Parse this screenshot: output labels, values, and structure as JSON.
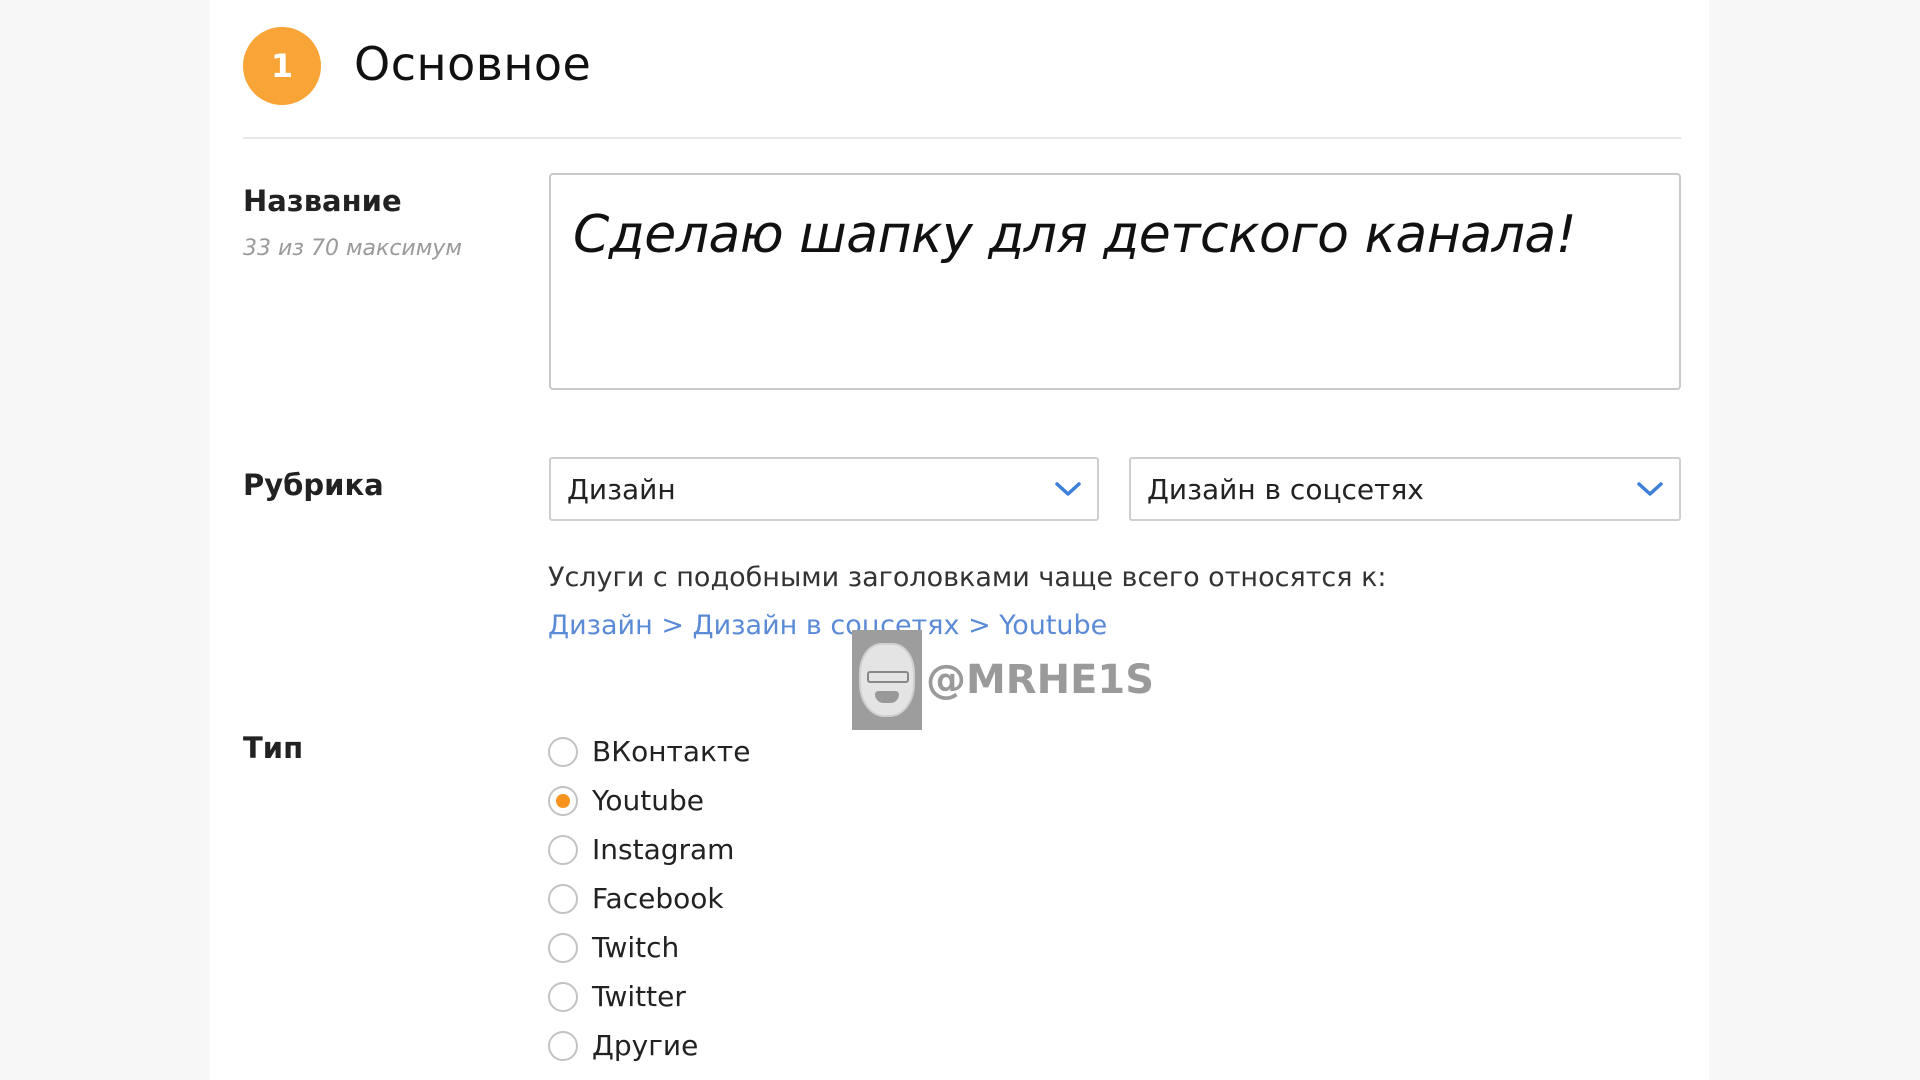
{
  "section": {
    "step_number": "1",
    "title": "Основное"
  },
  "name_field": {
    "label": "Название",
    "counter": "33 из 70 максимум",
    "value": "Сделаю шапку для детского канала!"
  },
  "category": {
    "label": "Рубрика",
    "primary_selected": "Дизайн",
    "secondary_selected": "Дизайн в соцсетях",
    "chevron_icon": "chevron-down-icon",
    "chevron_color": "#3d7fd9",
    "suggestion_text": "Услуги с подобными заголовками чаще всего относятся к:",
    "suggestion_link": "Дизайн > Дизайн в соцсетях > Youtube",
    "link_color": "#5b8bd6"
  },
  "type": {
    "label": "Тип",
    "selected": "Youtube",
    "accent_color": "#f7931e",
    "options": [
      {
        "label": "ВКонтакте",
        "checked": false
      },
      {
        "label": "Youtube",
        "checked": true
      },
      {
        "label": "Instagram",
        "checked": false
      },
      {
        "label": "Facebook",
        "checked": false
      },
      {
        "label": "Twitch",
        "checked": false
      },
      {
        "label": "Twitter",
        "checked": false
      },
      {
        "label": "Другие",
        "checked": false
      }
    ]
  },
  "watermark": {
    "text": "@MRHE1S"
  },
  "colors": {
    "step_badge": "#f9a436",
    "page_background": "#f7f7f7",
    "card_background": "#ffffff"
  }
}
